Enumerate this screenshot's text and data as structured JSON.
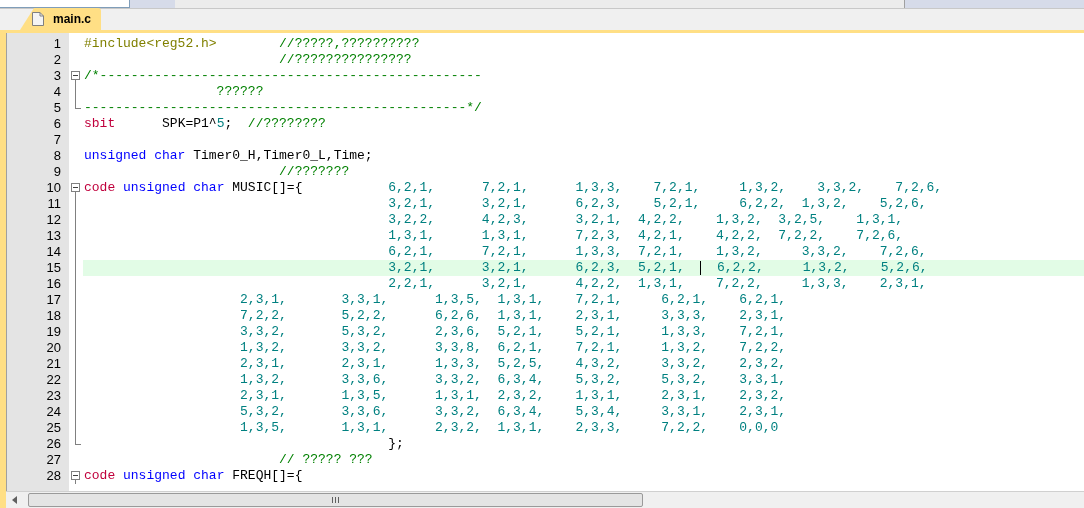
{
  "tabs": [
    {
      "label": "main.c",
      "selected": true
    }
  ],
  "editor": {
    "lines": [
      {
        "number": "1",
        "current": false,
        "segments": [
          {
            "kind": "preprocessor",
            "text": "#include<reg52.h>"
          },
          {
            "kind": "comment",
            "text": "        //?????,??????????"
          }
        ]
      },
      {
        "number": "2",
        "current": false,
        "segments": [
          {
            "kind": "comment",
            "text": "                         //???????????????"
          }
        ]
      },
      {
        "number": "3",
        "fold": {
          "kind": "start"
        },
        "current": false,
        "segments": [
          {
            "kind": "comment",
            "text": "/*-------------------------------------------------"
          }
        ]
      },
      {
        "number": "4",
        "fold": {
          "kind": "line"
        },
        "current": false,
        "segments": [
          {
            "kind": "comment",
            "text": "                 ??????"
          }
        ]
      },
      {
        "number": "5",
        "fold": {
          "kind": "end"
        },
        "current": false,
        "segments": [
          {
            "kind": "comment",
            "text": "-------------------------------------------------*/"
          }
        ]
      },
      {
        "number": "6",
        "current": false,
        "segments": [
          {
            "kind": "keyword",
            "text": "sbit"
          },
          {
            "kind": "plain",
            "text": "      SPK=P1^"
          },
          {
            "kind": "number",
            "text": "5"
          },
          {
            "kind": "plain",
            "text": ";"
          },
          {
            "kind": "comment",
            "text": "  //????????"
          }
        ]
      },
      {
        "number": "7",
        "current": false
      },
      {
        "number": "8",
        "current": false,
        "segments": [
          {
            "kind": "type",
            "text": "unsigned char"
          },
          {
            "kind": "plain",
            "text": " Timer0_H,Timer0_L,Time;"
          }
        ]
      },
      {
        "number": "9",
        "current": false,
        "segments": [
          {
            "kind": "comment",
            "text": "                         //???????"
          }
        ]
      },
      {
        "number": "10",
        "fold": {
          "kind": "start"
        },
        "current": false,
        "segments": [
          {
            "kind": "keyword",
            "text": "code"
          },
          {
            "kind": "type",
            "text": " unsigned char"
          },
          {
            "kind": "plain",
            "text": " MUSIC[]={"
          },
          {
            "kind": "number",
            "text": "           6,2,1,      7,2,1,      1,3,3,    7,2,1,     1,3,2,    3,3,2,    7,2,6,"
          }
        ]
      },
      {
        "number": "11",
        "fold": {
          "kind": "line"
        },
        "current": false,
        "segments": [
          {
            "kind": "number",
            "text": "                                       3,2,1,      3,2,1,      6,2,3,    5,2,1,     6,2,2,  1,3,2,    5,2,6,"
          }
        ]
      },
      {
        "number": "12",
        "fold": {
          "kind": "line"
        },
        "current": false,
        "segments": [
          {
            "kind": "number",
            "text": "                                       3,2,2,      4,2,3,      3,2,1,  4,2,2,    1,3,2,  3,2,5,    1,3,1,"
          }
        ]
      },
      {
        "number": "13",
        "fold": {
          "kind": "line"
        },
        "current": false,
        "segments": [
          {
            "kind": "number",
            "text": "                                       1,3,1,      1,3,1,      7,2,3,  4,2,1,    4,2,2,  7,2,2,    7,2,6,"
          }
        ]
      },
      {
        "number": "14",
        "fold": {
          "kind": "line"
        },
        "current": false,
        "segments": [
          {
            "kind": "number",
            "text": "                                       6,2,1,      7,2,1,      1,3,3,  7,2,1,    1,3,2,     3,3,2,    7,2,6,"
          }
        ]
      },
      {
        "number": "15",
        "fold": {
          "kind": "line"
        },
        "current": true,
        "segments": [
          {
            "kind": "number",
            "text": "                                       3,2,1,      3,2,1,      6,2,3,  5,2,1,  "
          },
          {
            "kind": "cursor"
          },
          {
            "kind": "number",
            "text": "  6,2,2,     1,3,2,    5,2,6,"
          }
        ]
      },
      {
        "number": "16",
        "fold": {
          "kind": "line"
        },
        "current": false,
        "segments": [
          {
            "kind": "number",
            "text": "                                       2,2,1,      3,2,1,      4,2,2,  1,3,1,    7,2,2,     1,3,3,    2,3,1,"
          }
        ]
      },
      {
        "number": "17",
        "fold": {
          "kind": "line"
        },
        "current": false,
        "segments": [
          {
            "kind": "number",
            "text": "                    2,3,1,       3,3,1,      1,3,5,  1,3,1,    7,2,1,     6,2,1,    6,2,1,"
          }
        ]
      },
      {
        "number": "18",
        "fold": {
          "kind": "line"
        },
        "current": false,
        "segments": [
          {
            "kind": "number",
            "text": "                    7,2,2,       5,2,2,      6,2,6,  1,3,1,    2,3,1,     3,3,3,    2,3,1,"
          }
        ]
      },
      {
        "number": "19",
        "fold": {
          "kind": "line"
        },
        "current": false,
        "segments": [
          {
            "kind": "number",
            "text": "                    3,3,2,       5,3,2,      2,3,6,  5,2,1,    5,2,1,     1,3,3,    7,2,1,"
          }
        ]
      },
      {
        "number": "20",
        "fold": {
          "kind": "line"
        },
        "current": false,
        "segments": [
          {
            "kind": "number",
            "text": "                    1,3,2,       3,3,2,      3,3,8,  6,2,1,    7,2,1,     1,3,2,    7,2,2,"
          }
        ]
      },
      {
        "number": "21",
        "fold": {
          "kind": "line"
        },
        "current": false,
        "segments": [
          {
            "kind": "number",
            "text": "                    2,3,1,       2,3,1,      1,3,3,  5,2,5,    4,3,2,     3,3,2,    2,3,2,"
          }
        ]
      },
      {
        "number": "22",
        "fold": {
          "kind": "line"
        },
        "current": false,
        "segments": [
          {
            "kind": "number",
            "text": "                    1,3,2,       3,3,6,      3,3,2,  6,3,4,    5,3,2,     5,3,2,    3,3,1,"
          }
        ]
      },
      {
        "number": "23",
        "fold": {
          "kind": "line"
        },
        "current": false,
        "segments": [
          {
            "kind": "number",
            "text": "                    2,3,1,       1,3,5,      1,3,1,  2,3,2,    1,3,1,     2,3,1,    2,3,2,"
          }
        ]
      },
      {
        "number": "24",
        "fold": {
          "kind": "line"
        },
        "current": false,
        "segments": [
          {
            "kind": "number",
            "text": "                    5,3,2,       3,3,6,      3,3,2,  6,3,4,    5,3,4,     3,3,1,    2,3,1,"
          }
        ]
      },
      {
        "number": "25",
        "fold": {
          "kind": "line"
        },
        "current": false,
        "segments": [
          {
            "kind": "number",
            "text": "                    1,3,5,       1,3,1,      2,3,2,  1,3,1,    2,3,3,     7,2,2,    0,0,0"
          }
        ]
      },
      {
        "number": "26",
        "fold": {
          "kind": "end"
        },
        "current": false,
        "segments": [
          {
            "kind": "plain",
            "text": "                                       };"
          }
        ]
      },
      {
        "number": "27",
        "current": false,
        "segments": [
          {
            "kind": "comment",
            "text": "                         // ????? ???"
          }
        ]
      },
      {
        "number": "28",
        "fold": {
          "kind": "start"
        },
        "current": false,
        "segments": [
          {
            "kind": "keyword",
            "text": "code"
          },
          {
            "kind": "type",
            "text": " unsigned char"
          },
          {
            "kind": "plain",
            "text": " FREQH[]={"
          }
        ]
      }
    ]
  }
}
